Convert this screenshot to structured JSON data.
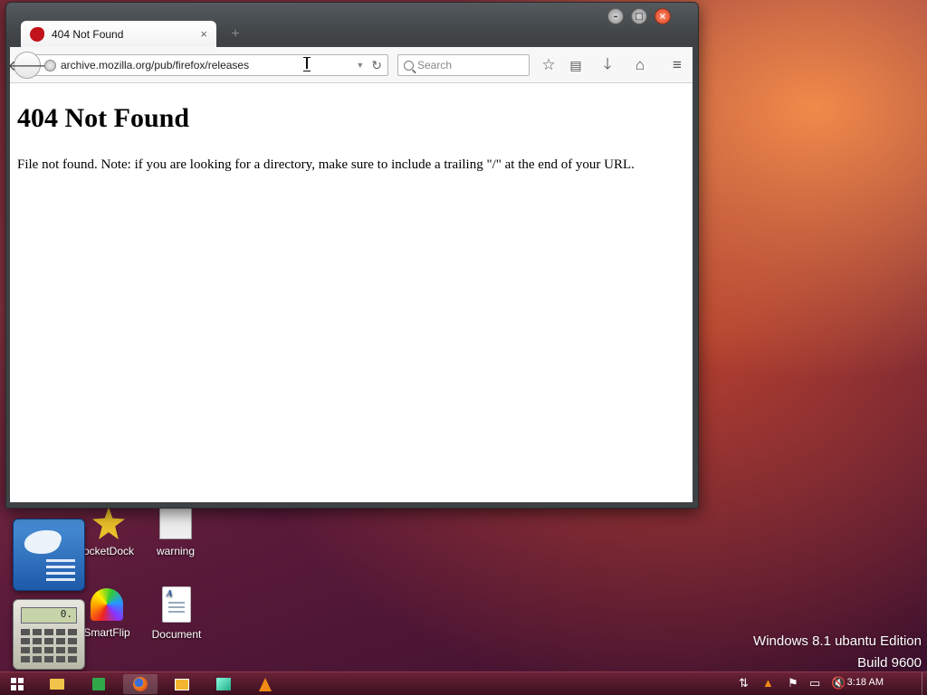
{
  "desktop": {
    "icons": [
      {
        "label": "ocketDock"
      },
      {
        "label": "warning"
      },
      {
        "label": "SmartFlip"
      },
      {
        "label": "Document"
      }
    ],
    "dock": {
      "calc_display": "0."
    },
    "watermark": {
      "line1": "Windows 8.1 ubantu Edition",
      "line2": "Build 9600"
    }
  },
  "browser": {
    "tab": {
      "title": "404 Not Found",
      "close": "×"
    },
    "newtab": "+",
    "url": "archive.mozilla.org/pub/firefox/releases",
    "search_placeholder": "Search",
    "page": {
      "heading": "404 Not Found",
      "message": "File not found. Note: if you are looking for a directory, make sure to include a trailing \"/\" at the end of your URL."
    }
  },
  "taskbar": {
    "clock": "3:18 AM"
  },
  "colors": {
    "accent": "#c0141a",
    "taskbar": "#4a1428"
  }
}
